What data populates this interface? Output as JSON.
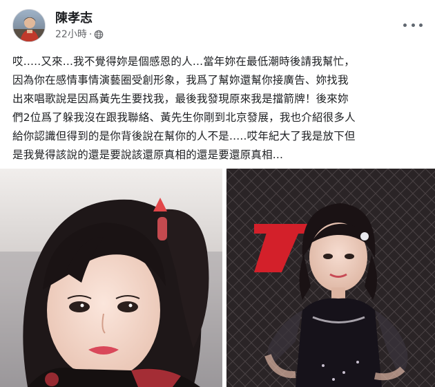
{
  "post": {
    "author": "陳孝志",
    "time": "22小時",
    "separator": "·",
    "audience_icon": "globe-icon",
    "more_icon": "more-options-icon",
    "text_lines": [
      "哎.....又來...我不覺得妳是個感恩的人...當年妳在最低潮時後請我幫忙，",
      "因為你在感情事情演藝圈受創形象，我爲了幫妳還幫你接廣告、妳找我",
      "出來唱歌說是因爲黃先生要找我，最後我發現原來我是擋箭牌！後來妳",
      "們2位爲了躲我沒在跟我聯絡、黃先生你剛到北京發展，我也介紹很多人",
      "給你認識但得到的是你背後說在幫你的人不是.....哎年紀大了我是放下但",
      "是我覺得該說的還是要說該還原真相的還是要還原真相..."
    ]
  },
  "photos": [
    {
      "name": "photo-left",
      "description_icon": "portrait-photo-icon"
    },
    {
      "name": "photo-right",
      "description_icon": "stage-photo-icon"
    }
  ],
  "colors": {
    "text": "#1c1e21",
    "secondary": "#65676b",
    "background": "#ffffff"
  }
}
